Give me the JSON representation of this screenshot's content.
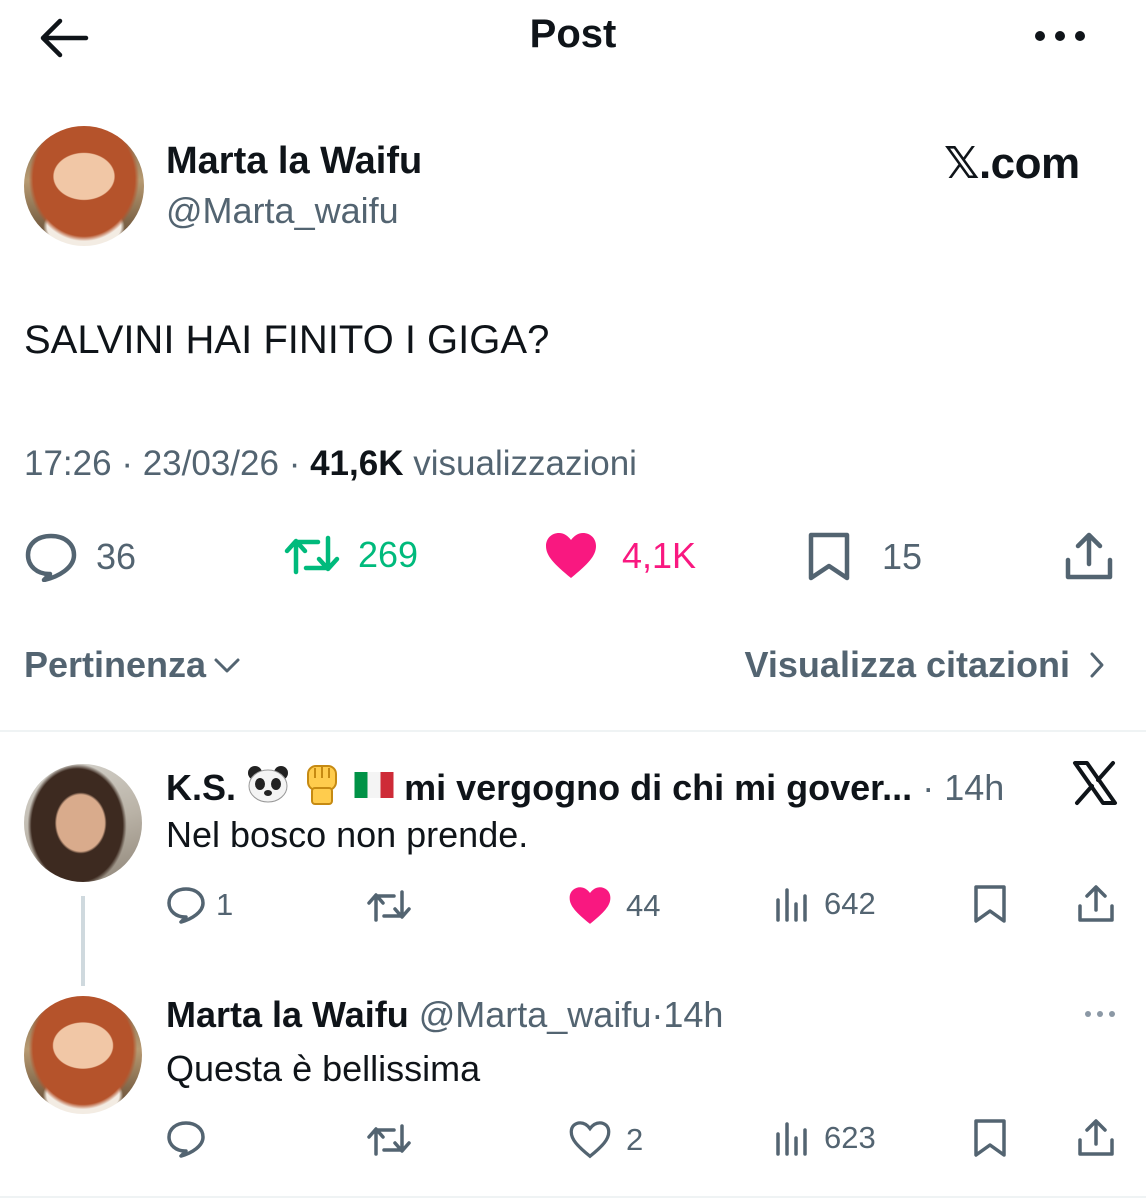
{
  "header": {
    "title": "Post"
  },
  "post": {
    "author_name": "Marta la Waifu",
    "author_handle": "@Marta_waifu",
    "watermark": "𝕏.com",
    "text": "SALVINI HAI FINITO I GIGA?",
    "time": "17:26",
    "date": "23/03/26",
    "views_count": "41,6K",
    "views_label": "visualizzazioni",
    "sep": "·",
    "actions": {
      "replies": "36",
      "reposts": "269",
      "likes": "4,1K",
      "bookmarks": "15"
    },
    "liked": true
  },
  "sort": {
    "label": "Pertinenza"
  },
  "quotes": {
    "label": "Visualizza citazioni"
  },
  "replies": [
    {
      "author_name_prefix": "K.S.",
      "author_name_suffix": "mi vergogno di chi mi gover...",
      "emojis": [
        "panda-face",
        "raised-fist",
        "italy-flag"
      ],
      "time": "14h",
      "text": "Nel bosco non prende.",
      "actions": {
        "replies": "1",
        "reposts": "",
        "likes": "44",
        "views": "642"
      },
      "liked": true
    },
    {
      "author_name": "Marta la Waifu",
      "author_handle": "@Marta_waifu",
      "time": "14h",
      "text": "Questa è bellissima",
      "actions": {
        "replies": "",
        "reposts": "",
        "likes": "2",
        "views": "623"
      },
      "liked": false
    }
  ],
  "colors": {
    "like": "#f91880",
    "repost": "#00ba7c",
    "muted": "#536471",
    "text": "#0f1419"
  }
}
